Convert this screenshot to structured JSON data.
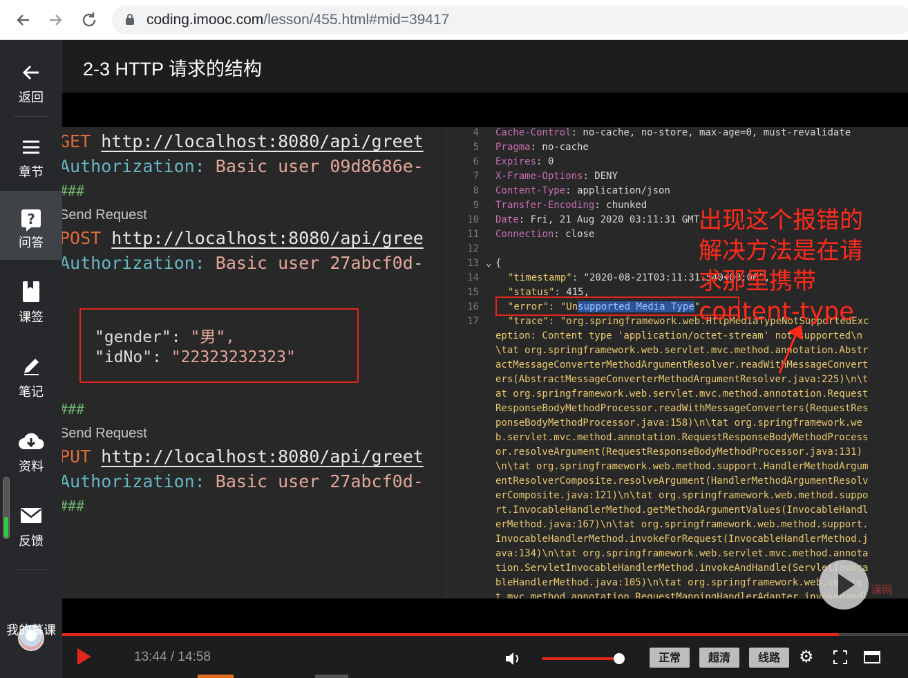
{
  "browser": {
    "url_host": "coding.imooc.com",
    "url_rest": "/lesson/455.html#mid=39417",
    "back_icon": "arrow-left",
    "forward_icon": "arrow-right",
    "reload_icon": "reload"
  },
  "sidebar": {
    "items": [
      {
        "label": "返回",
        "icon": "back-arrow"
      },
      {
        "label": "章节",
        "icon": "menu-lines"
      },
      {
        "label": "问答",
        "icon": "question"
      },
      {
        "label": "课签",
        "icon": "bookmark"
      },
      {
        "label": "笔记",
        "icon": "pencil"
      },
      {
        "label": "资料",
        "icon": "cloud-download"
      },
      {
        "label": "反馈",
        "icon": "mail"
      },
      {
        "label": "我的慕课",
        "icon": "avatar"
      }
    ],
    "volume_level": 0.35
  },
  "header": {
    "title": "2-3 HTTP 请求的结构"
  },
  "left_editor": {
    "get_method": "GET",
    "get_url": "http://localhost:8080/api/greet",
    "auth1_key": "Authorization:",
    "auth1_val": "Basic user 09d8686e-",
    "hash1": "###",
    "send1": "Send Request",
    "post_method": "POST",
    "post_url": "http://localhost:8080/api/gree",
    "auth2_key": "Authorization:",
    "auth2_val": "Basic user 27abcf0d-",
    "json_gender_key": "\"gender\":",
    "json_gender_val": "\"男\",",
    "json_idno_key": "\"idNo\":",
    "json_idno_val": "\"22323232323\"",
    "hash2": "###",
    "send2": "Send Request",
    "put_method": "PUT",
    "put_url": "http://localhost:8080/api/greet",
    "auth3_key": "Authorization:",
    "auth3_val": "Basic user 27abcf0d-",
    "hash3": "###"
  },
  "right_editor": {
    "lines": [
      {
        "n": "4",
        "k": "Cache-Control",
        "v": ": no-cache, no-store, max-age=0, must-revalidate"
      },
      {
        "n": "5",
        "k": "Pragma",
        "v": ": no-cache"
      },
      {
        "n": "6",
        "k": "Expires",
        "v": ": 0"
      },
      {
        "n": "7",
        "k": "X-Frame-Options",
        "v": ": DENY"
      },
      {
        "n": "8",
        "k": "Content-Type",
        "v": ": application/json"
      },
      {
        "n": "9",
        "k": "Transfer-Encoding",
        "v": ": chunked"
      },
      {
        "n": "10",
        "k": "Date",
        "v": ": Fri, 21 Aug 2020 03:11:31 GMT"
      },
      {
        "n": "11",
        "k": "Connection",
        "v": ": close"
      }
    ],
    "ln12": "12",
    "ln13": "13",
    "brace": "{",
    "ln14": "14",
    "timestamp_key": "\"timestamp\"",
    "timestamp_val": ": \"2020-08-21T03:11:31.540+00:00\",",
    "ln15": "15",
    "status_key": "\"status\"",
    "status_val": ": 415,",
    "ln16": "16",
    "error_key": "\"error\"",
    "error_pre": ": \"Un",
    "error_sel": "supported Media Type",
    "error_post": "\",",
    "ln17": "17",
    "trace_key": "\"trace\"",
    "trace_first": ": \"org.springframework.web.HttpMediaTypeNotSupportedExc",
    "trace_lines": [
      "eption: Content type 'application/octet-stream' not supported\\n",
      "\\tat org.springframework.web.servlet.mvc.method.annotation.Abstr",
      "actMessageConverterMethodArgumentResolver.readWithMessageConvert",
      "ers(AbstractMessageConverterMethodArgumentResolver.java:225)\\n\\t",
      "at org.springframework.web.servlet.mvc.method.annotation.Request",
      "ResponseBodyMethodProcessor.readWithMessageConverters(RequestRes",
      "ponseBodyMethodProcessor.java:158)\\n\\tat org.springframework.we",
      "b.servlet.mvc.method.annotation.RequestResponseBodyMethodProcess",
      "or.resolveArgument(RequestResponseBodyMethodProcessor.java:131)",
      "\\n\\tat org.springframework.web.method.support.HandlerMethodArgum",
      "entResolverComposite.resolveArgument(HandlerMethodArgumentResolv",
      "erComposite.java:121)\\n\\tat org.springframework.web.method.suppo",
      "rt.InvocableHandlerMethod.getMethodArgumentValues(InvocableHandl",
      "erMethod.java:167)\\n\\tat org.springframework.web.method.support.",
      "InvocableHandlerMethod.invokeForRequest(InvocableHandlerMethod.j",
      "ava:134)\\n\\tat org.springframework.web.servlet.mvc.method.annota",
      "tion.ServletInvocableHandlerMethod.invokeAndHandle(ServletInvoca",
      "bleHandlerMethod.java:105)\\n\\tat org.springframework.web.servle",
      "t.mvc.method.annotation.RequestMappingHandlerAdapter.invokeHandl"
    ]
  },
  "annotation": {
    "line1": "出现这个报错的",
    "line2": "解决方法是在请",
    "line3": "求那里携带",
    "line4": "content-type",
    "color": "#ff2a1a"
  },
  "watermark": "课网",
  "player": {
    "current_time": "13:44",
    "separator": " / ",
    "total_time": "14:58",
    "progress_fraction": 0.9183,
    "volume_fraction": 0.9,
    "speed_label": "正常",
    "quality_label": "超清",
    "line_label": "线路",
    "accent": "#e0261b"
  }
}
